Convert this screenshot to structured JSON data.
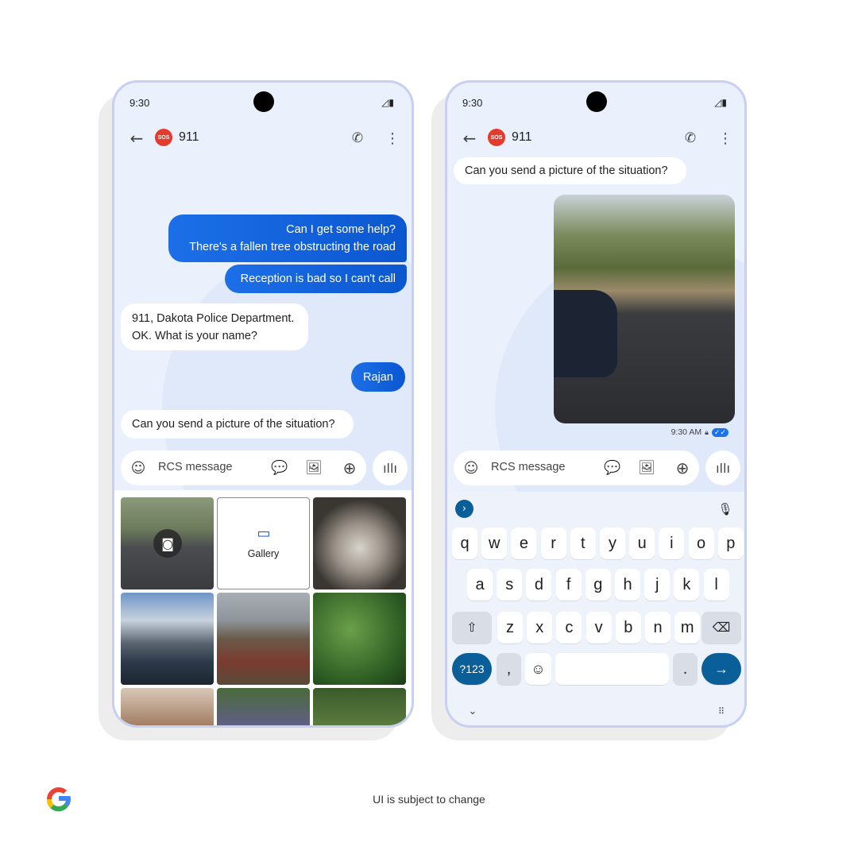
{
  "left_phone": {
    "status_time": "9:30",
    "contact_name": "911",
    "sos_badge": "SOS",
    "messages": [
      {
        "from": "me",
        "lines": [
          "Can I get some help?",
          "There's a fallen tree obstructing the road"
        ]
      },
      {
        "from": "me",
        "lines": [
          "Reception is bad so I can't call"
        ]
      },
      {
        "from": "them",
        "lines": [
          "911, Dakota Police Department.",
          "OK. What is your name?"
        ]
      },
      {
        "from": "me",
        "lines": [
          "Rajan"
        ]
      },
      {
        "from": "them",
        "lines": [
          "Can you send a picture of the situation?"
        ]
      }
    ],
    "input_placeholder": "RCS message",
    "gallery_label": "Gallery"
  },
  "right_phone": {
    "status_time": "9:30",
    "contact_name": "911",
    "sos_badge": "SOS",
    "received_message": "Can you send a picture of the situation?",
    "timestamp": "9:30 AM",
    "input_placeholder": "RCS message",
    "keyboard": {
      "row1": [
        "q",
        "w",
        "e",
        "r",
        "t",
        "y",
        "u",
        "i",
        "o",
        "p"
      ],
      "row2": [
        "a",
        "s",
        "d",
        "f",
        "g",
        "h",
        "j",
        "k",
        "l"
      ],
      "row3": [
        "z",
        "x",
        "c",
        "v",
        "b",
        "n",
        "m"
      ],
      "symbols_key": "?123",
      "comma": ",",
      "period": "."
    }
  },
  "footer": {
    "disclaimer": "UI is subject to change"
  },
  "colors": {
    "accent": "#0b57d0",
    "sos": "#e53b2c",
    "enter_key": "#0b5f99"
  }
}
